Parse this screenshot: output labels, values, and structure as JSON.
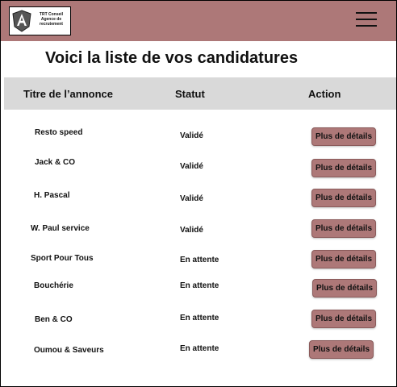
{
  "header": {
    "logo_lines": [
      "TRT Conseil",
      "Agence de",
      "recrutement"
    ],
    "logo_icon": "angular-shield-icon",
    "menu_icon": "hamburger-menu-icon",
    "color": "#ad7878"
  },
  "page_title": "Voici la liste de vos candidatures",
  "table": {
    "columns": [
      "Titre de l’annonce",
      "Statut",
      "Action"
    ],
    "rows": [
      {
        "title": "Resto speed",
        "status": "Validé",
        "action": "Plus de détails"
      },
      {
        "title": "Jack & CO",
        "status": "Validé",
        "action": "Plus de détails"
      },
      {
        "title": "H. Pascal",
        "status": "Validé",
        "action": "Plus de détails"
      },
      {
        "title": "W. Paul service",
        "status": "Validé",
        "action": "Plus de détails"
      },
      {
        "title": "Sport Pour Tous",
        "status": "En attente",
        "action": "Plus de détails"
      },
      {
        "title": "Bouchérie",
        "status": "En attente",
        "action": "Plus de détails"
      },
      {
        "title": "Ben & CO",
        "status": "En attente",
        "action": "Plus de détails"
      },
      {
        "title": "Oumou & Saveurs",
        "status": "En attente",
        "action": "Plus de détails"
      }
    ]
  }
}
